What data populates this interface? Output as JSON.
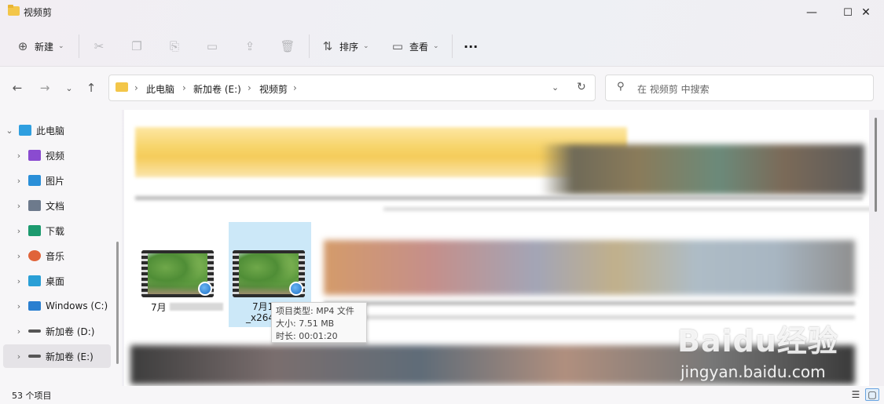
{
  "window": {
    "title": "视频剪",
    "minimize": "—",
    "maximize": "☐",
    "close": "✕"
  },
  "toolbar": {
    "new_label": "新建",
    "sort_label": "排序",
    "view_label": "查看",
    "more_label": "···"
  },
  "nav": {
    "breadcrumbs": [
      "此电脑",
      "新加卷 (E:)",
      "视频剪"
    ],
    "search_placeholder": "在 视频剪 中搜索"
  },
  "sidebar": {
    "items": [
      {
        "label": "此电脑",
        "icon": "computer-icon",
        "color": "#2f9fe0"
      },
      {
        "label": "视频",
        "icon": "video-icon",
        "color": "#8a4bd0"
      },
      {
        "label": "图片",
        "icon": "picture-icon",
        "color": "#2a8fd8"
      },
      {
        "label": "文档",
        "icon": "document-icon",
        "color": "#6d7a8c"
      },
      {
        "label": "下载",
        "icon": "download-icon",
        "color": "#1c9a6e"
      },
      {
        "label": "音乐",
        "icon": "music-icon",
        "color": "#e0643a"
      },
      {
        "label": "桌面",
        "icon": "desktop-icon",
        "color": "#2a9fd6"
      },
      {
        "label": "Windows (C:)",
        "icon": "drive-c-icon",
        "color": "#2a7fd0"
      },
      {
        "label": "新加卷 (D:)",
        "icon": "drive-d-icon",
        "color": "#555555"
      },
      {
        "label": "新加卷 (E:)",
        "icon": "drive-e-icon",
        "color": "#555555"
      }
    ]
  },
  "files": [
    {
      "label": "7月"
    },
    {
      "label": "7月1",
      "label2": "_x264"
    }
  ],
  "tooltip": {
    "type": "项目类型: MP4 文件",
    "size": "大小: 7.51 MB",
    "duration": "时长: 00:01:20"
  },
  "status": {
    "count": "53 个项目"
  },
  "watermark": {
    "line1": "Baidu经验",
    "line2": "jingyan.baidu.com"
  }
}
